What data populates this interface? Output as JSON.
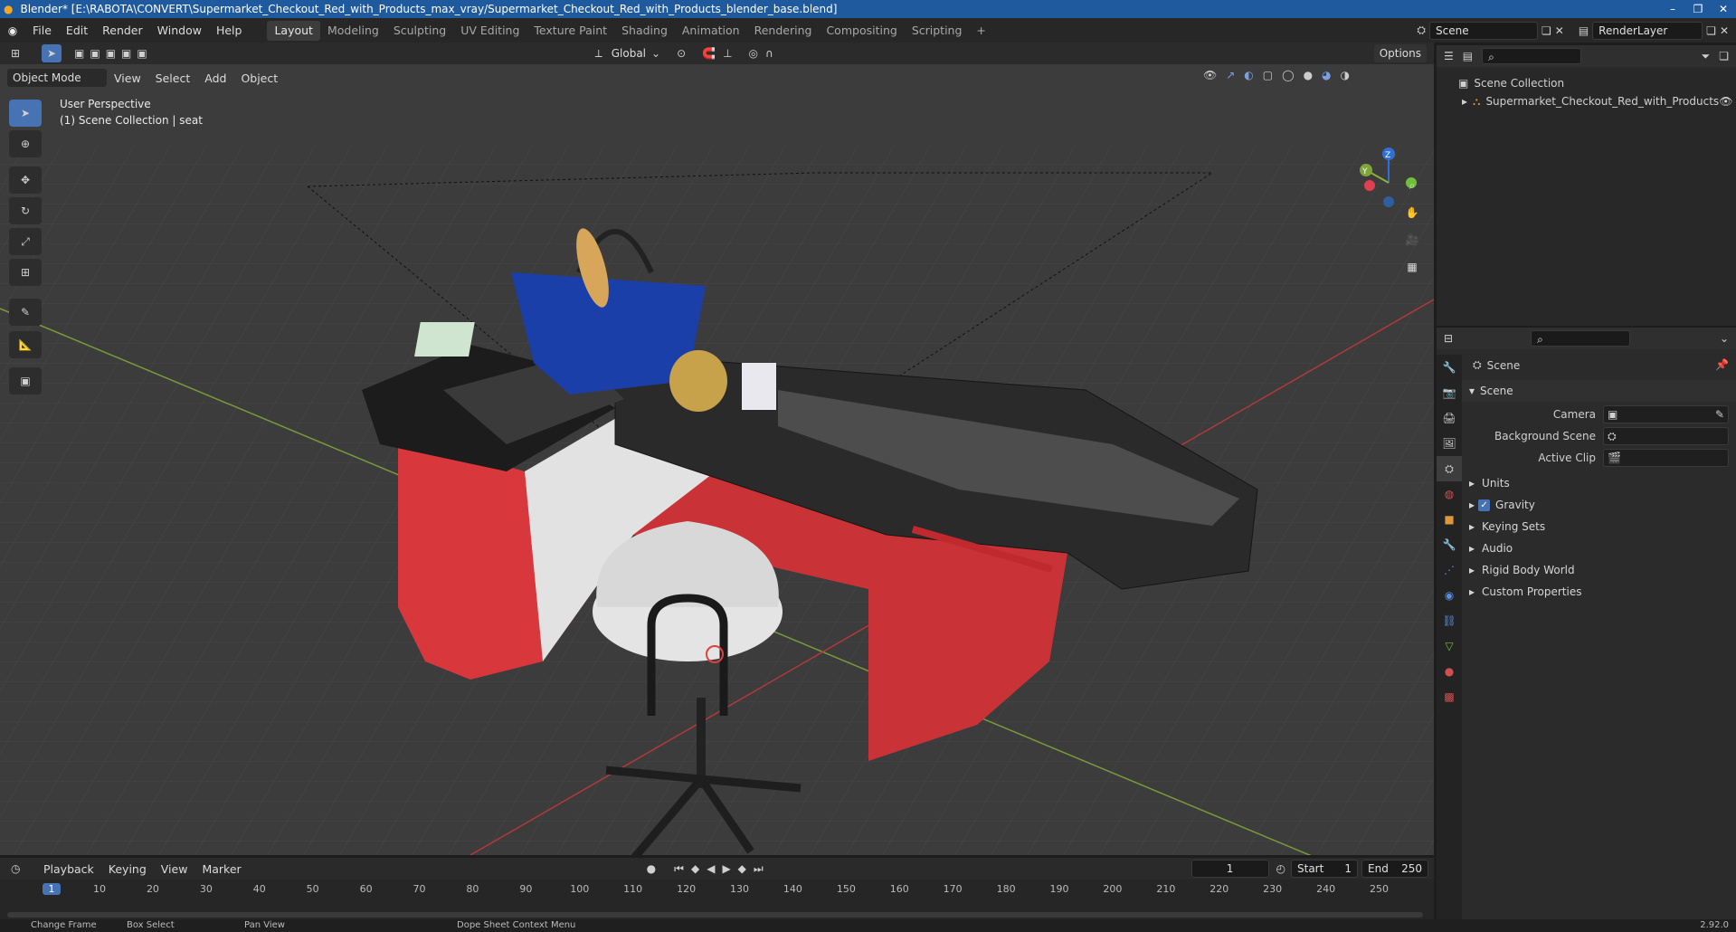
{
  "window": {
    "title": "Blender* [E:\\RABOTA\\CONVERT\\Supermarket_Checkout_Red_with_Products_max_vray/Supermarket_Checkout_Red_with_Products_blender_base.blend]"
  },
  "menu": [
    "File",
    "Edit",
    "Render",
    "Window",
    "Help"
  ],
  "workspaces": [
    "Layout",
    "Modeling",
    "Sculpting",
    "UV Editing",
    "Texture Paint",
    "Shading",
    "Animation",
    "Rendering",
    "Compositing",
    "Scripting"
  ],
  "active_workspace": "Layout",
  "scene_field": "Scene",
  "renderlayer_field": "RenderLayer",
  "viewport": {
    "orientation": "Global",
    "options_label": "Options",
    "mode": "Object Mode",
    "header_menu": [
      "View",
      "Select",
      "Add",
      "Object"
    ],
    "overlay_line1": "User Perspective",
    "overlay_line2": "(1) Scene Collection | seat",
    "gizmo_labels": {
      "z": "Z",
      "y": "Y"
    }
  },
  "outliner": {
    "root": "Scene Collection",
    "items": [
      "Supermarket_Checkout_Red_with_Products"
    ]
  },
  "properties": {
    "breadcrumb": "Scene",
    "panel": "Scene",
    "fields": [
      {
        "label": "Camera",
        "value": ""
      },
      {
        "label": "Background Scene",
        "value": ""
      },
      {
        "label": "Active Clip",
        "value": ""
      }
    ],
    "subpanels": [
      {
        "label": "Units",
        "checkbox": false
      },
      {
        "label": "Gravity",
        "checkbox": true
      },
      {
        "label": "Keying Sets",
        "checkbox": false
      },
      {
        "label": "Audio",
        "checkbox": false
      },
      {
        "label": "Rigid Body World",
        "checkbox": false
      },
      {
        "label": "Custom Properties",
        "checkbox": false
      }
    ]
  },
  "timeline": {
    "menus": [
      "Playback",
      "Keying",
      "View",
      "Marker"
    ],
    "current_frame": "1",
    "start_label": "Start",
    "start": "1",
    "end_label": "End",
    "end": "250",
    "ticks": [
      "1",
      "10",
      "20",
      "30",
      "40",
      "50",
      "60",
      "70",
      "80",
      "90",
      "100",
      "110",
      "120",
      "130",
      "140",
      "150",
      "160",
      "170",
      "180",
      "190",
      "200",
      "210",
      "220",
      "230",
      "240",
      "250"
    ]
  },
  "statusbar": {
    "items": [
      "Change Frame",
      "Box Select",
      "Pan View",
      "Dope Sheet Context Menu"
    ],
    "version": "2.92.0"
  },
  "colors": {
    "accent": "#4772b3",
    "titlebar": "#1f5a9e",
    "red_counter": "#d8383c",
    "basket": "#1b3fa8"
  }
}
